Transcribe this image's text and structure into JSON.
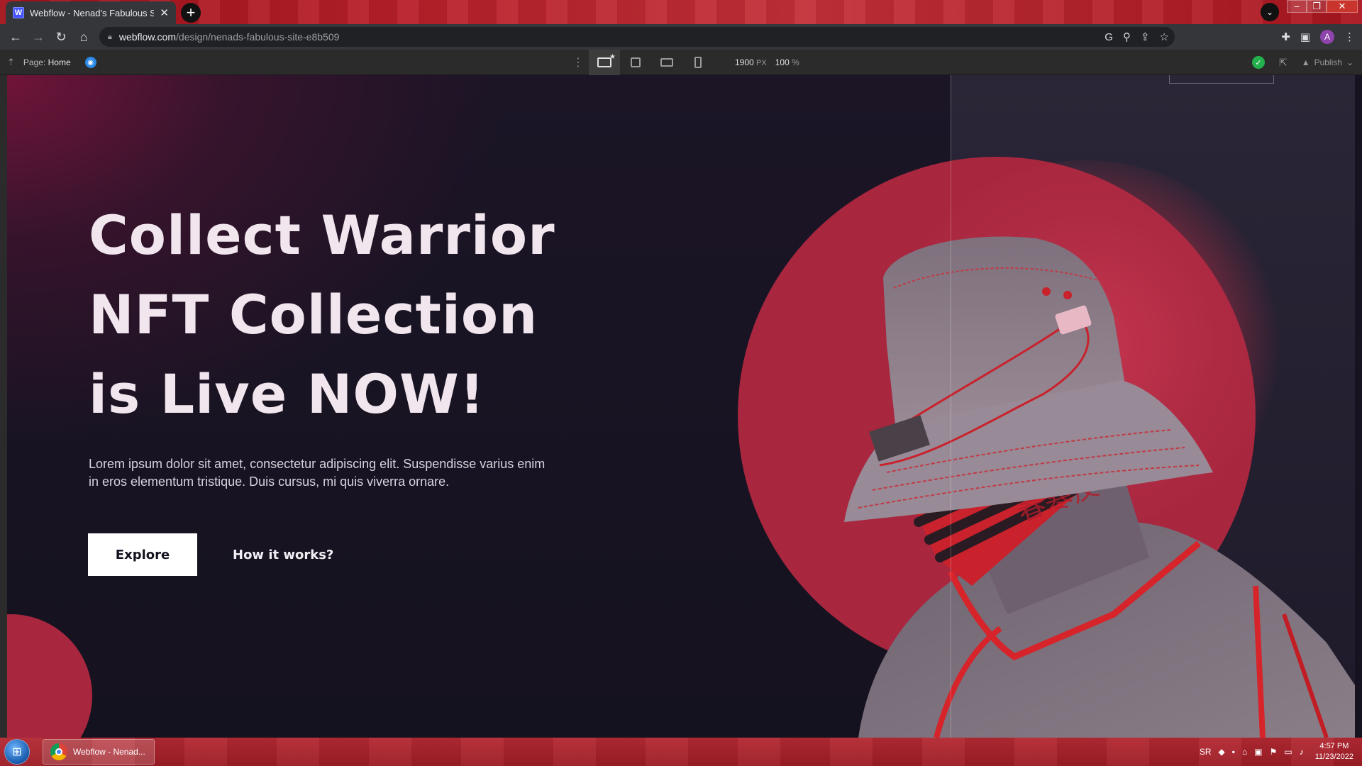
{
  "browser": {
    "tab_title": "Webflow - Nenad's Fabulous Site",
    "tab_favicon": "W",
    "new_tab": "+",
    "url_domain": "webflow.com",
    "url_path": "/design/nenads-fabulous-site-e8b509",
    "profile_initial": "A"
  },
  "designer": {
    "page_prefix": "Page:",
    "page_name": "Home",
    "width_value": "1900",
    "width_unit": "PX",
    "zoom_value": "100",
    "zoom_unit": "%",
    "publish_label": "Publish"
  },
  "hero": {
    "title_line1": "Collect Warrior",
    "title_line2": "NFT Collection",
    "title_line3": "is Live NOW!",
    "body": "Lorem ipsum dolor sit amet, consectetur adipiscing elit. Suspendisse varius enim in eros elementum tristique. Duis cursus, mi quis viverra ornare.",
    "primary_button": "Explore",
    "secondary_button": "How it works?"
  },
  "taskbar": {
    "task_label": "Webflow - Nenad...",
    "language": "SR",
    "time": "4:57 PM",
    "date": "11/23/2022"
  },
  "colors": {
    "accent_red": "#a8273f",
    "background": "#16121f",
    "title_text": "#f2e6ee"
  }
}
